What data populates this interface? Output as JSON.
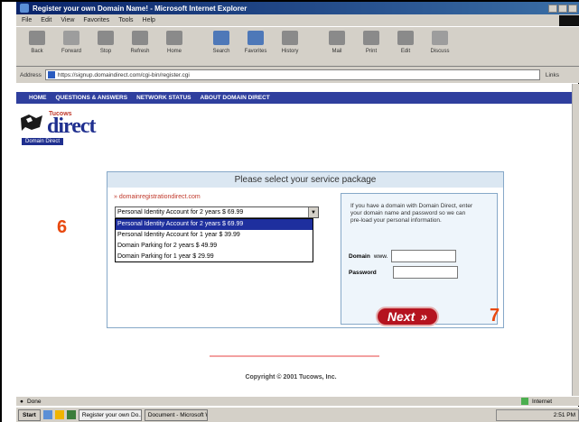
{
  "window": {
    "title": "Register your own Domain Name! - Microsoft Internet Explorer"
  },
  "menu": [
    "File",
    "Edit",
    "View",
    "Favorites",
    "Tools",
    "Help"
  ],
  "toolbar": {
    "buttons": [
      "Back",
      "Forward",
      "Stop",
      "Refresh",
      "Home",
      "Search",
      "Favorites",
      "History",
      "Mail",
      "Print",
      "Edit",
      "Discuss"
    ]
  },
  "address": {
    "label_address": "Address",
    "url": "https://signup.domaindirect.com/cgi-bin/register.cgi",
    "go": "Links"
  },
  "site_nav": [
    "HOME",
    "QUESTIONS & ANSWERS",
    "NETWORK STATUS",
    "ABOUT DOMAIN DIRECT"
  ],
  "brand": {
    "small": "Tucows",
    "big": "direct",
    "tag": "Domain Direct"
  },
  "panel": {
    "heading": "Please select your service package",
    "domain": "domainregistrationdirect.com",
    "selected_value": "Personal Identity Account for 2 years $ 69.99",
    "options": [
      "Personal Identity Account for 2 years $ 69.99",
      "Personal Identity Account for 1 year $ 39.99",
      "Domain Parking for 2 years $ 49.99",
      "Domain Parking for 1 year $ 29.99"
    ]
  },
  "side": {
    "text": "If you have a domain with Domain Direct, enter your domain name and password so we can pre-load your personal information.",
    "domain_label": "Domain",
    "domain_prefix": "www.",
    "password_label": "Password"
  },
  "next": {
    "label": "Next",
    "arrow": "»"
  },
  "footer": {
    "copyright": "Copyright © 2001 Tucows, Inc."
  },
  "annotations": {
    "six": "6",
    "seven": "7"
  },
  "status": {
    "left": "Done",
    "zone": "Internet"
  },
  "taskbar": {
    "start": "Start",
    "buttons": [
      "Register your own Do...",
      "Document - Microsoft Word"
    ],
    "clock": "2:51 PM"
  }
}
